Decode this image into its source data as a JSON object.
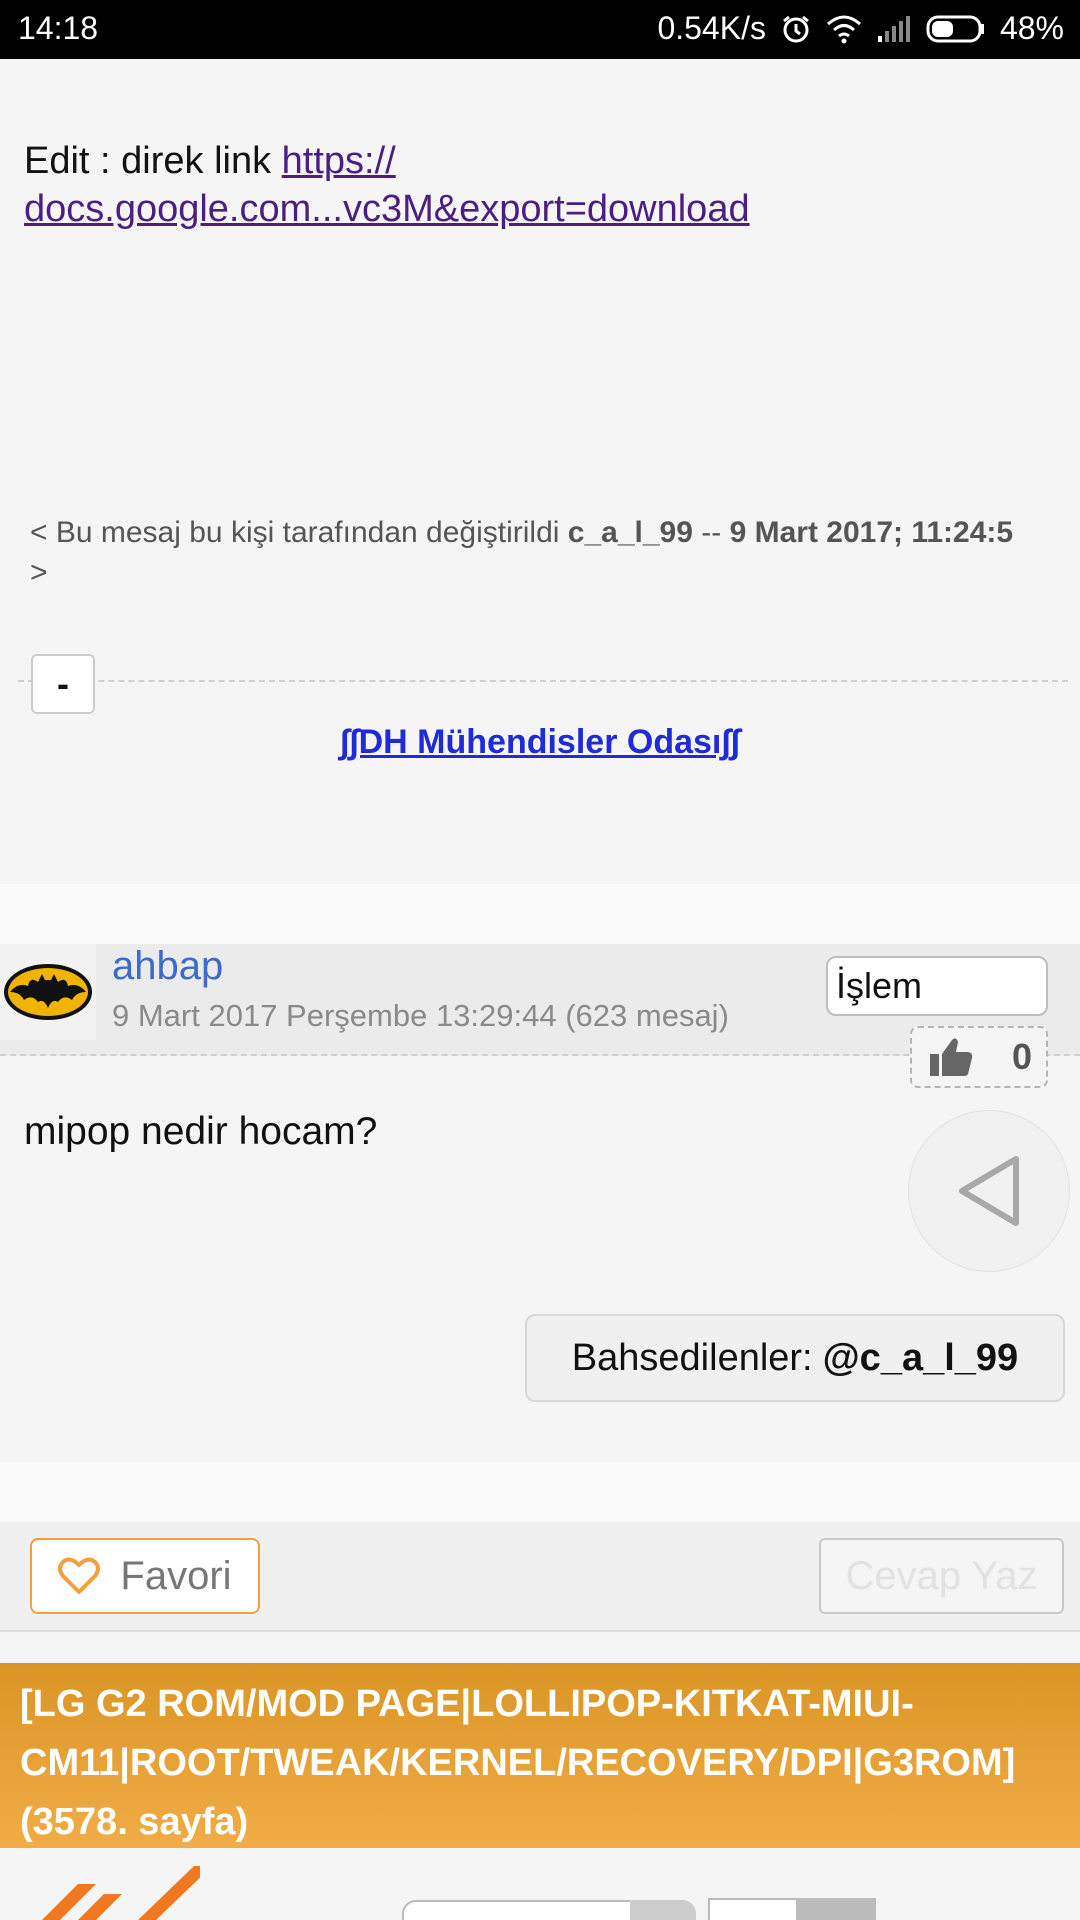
{
  "status_bar": {
    "time": "14:18",
    "network_speed": "0.54K/s",
    "battery": "48%",
    "battery_level": 0.48
  },
  "post1": {
    "edit_prefix": "Edit : direk link ",
    "link_line1": "https://",
    "link_line2": "docs.google.com...vc3M&export=download",
    "edited_prefix": "< Bu mesaj bu kişi tarafından değiştirildi ",
    "edited_user": "c_a_l_99",
    "edited_sep": " -- ",
    "edited_date": "9 Mart 2017; 11:24:5",
    "edited_suffix": " >",
    "collapse_label": "-",
    "signature_link": "∫∫DH Mühendisler Odası∫∫"
  },
  "post2": {
    "username": "ahbap",
    "meta": "9 Mart 2017 Perşembe 13:29:44 (623 mesaj)",
    "action_label": "İşlem",
    "like_count": "0",
    "body": "mipop nedir hocam?",
    "mentions_label": "Bahsedilenler:",
    "mentions_user": "@c_a_l_99"
  },
  "actions": {
    "favorite_label": "Favori",
    "reply_label": "Cevap Yaz"
  },
  "topic": {
    "title": "[LG G2 ROM/MOD PAGE|LOLLIPOP-KITKAT-MIUI-CM11|ROOT/TWEAK/KERNEL/RECOVERY/DPI|G3ROM] (3578. sayfa)"
  },
  "colors": {
    "accent_orange": "#f0a040",
    "link_purple": "#4b1f7f",
    "signature_blue": "#1f2bd6",
    "username_blue": "#3c6cc7"
  },
  "icons": [
    "alarm-icon",
    "wifi-icon",
    "signal-icon",
    "battery-icon",
    "batman-avatar-icon",
    "thumbs-up-icon",
    "back-triangle-icon",
    "heart-icon",
    "logo-slash-icon"
  ]
}
